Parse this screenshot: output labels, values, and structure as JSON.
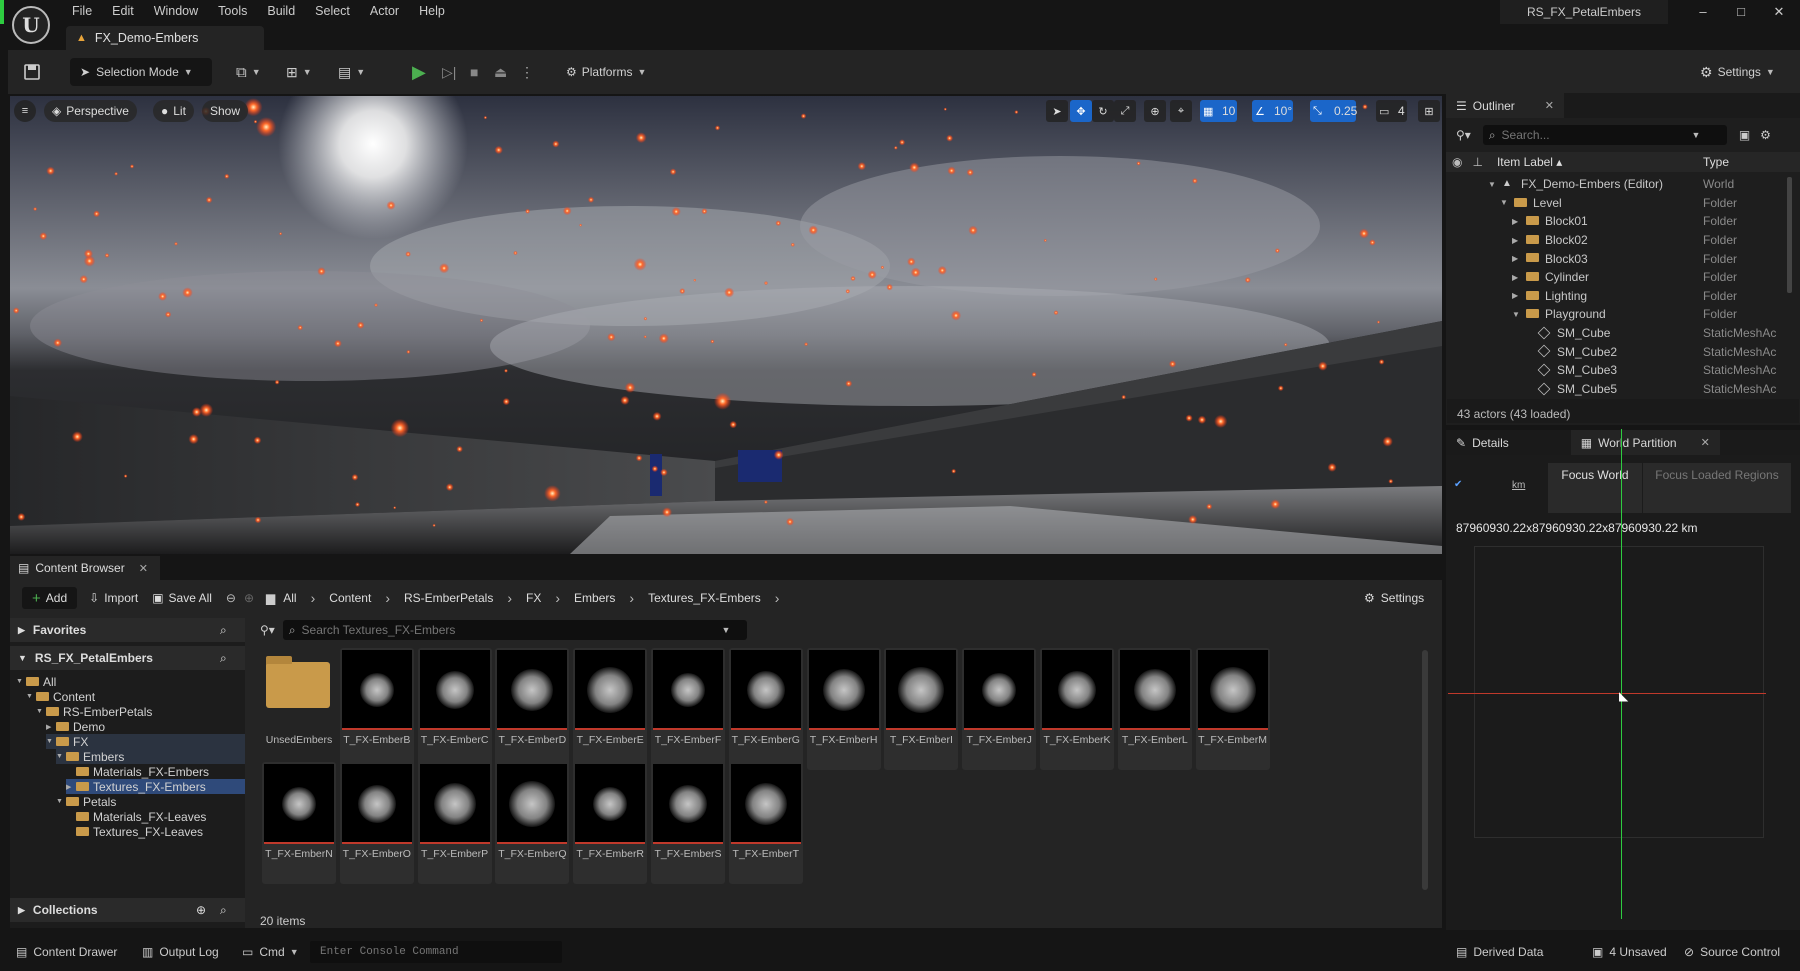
{
  "window": {
    "level_tab": "FX_Demo-Embers",
    "project_name": "RS_FX_PetalEmbers",
    "controls": [
      "–",
      "□",
      "✕"
    ]
  },
  "menu": [
    "File",
    "Edit",
    "Window",
    "Tools",
    "Build",
    "Select",
    "Actor",
    "Help"
  ],
  "toolbar": {
    "selection_mode": "Selection Mode",
    "platforms": "Platforms",
    "settings": "Settings"
  },
  "viewport": {
    "perspective": "Perspective",
    "lit": "Lit",
    "show": "Show",
    "grid_snap": "10",
    "rotation_snap": "10°",
    "scale_snap": "0.25",
    "camera_speed": "4"
  },
  "outliner": {
    "tab": "Outliner",
    "search_placeholder": "Search...",
    "col_label": "Item Label ▴",
    "col_type": "Type",
    "rows": [
      {
        "label": "FX_Demo-Embers (Editor)",
        "type": "World",
        "indent": 0,
        "icon": "world"
      },
      {
        "label": "Level",
        "type": "Folder",
        "indent": 1,
        "icon": "folder"
      },
      {
        "label": "Block01",
        "type": "Folder",
        "indent": 2,
        "icon": "folder"
      },
      {
        "label": "Block02",
        "type": "Folder",
        "indent": 2,
        "icon": "folder"
      },
      {
        "label": "Block03",
        "type": "Folder",
        "indent": 2,
        "icon": "folder"
      },
      {
        "label": "Cylinder",
        "type": "Folder",
        "indent": 2,
        "icon": "folder"
      },
      {
        "label": "Lighting",
        "type": "Folder",
        "indent": 2,
        "icon": "folder"
      },
      {
        "label": "Playground",
        "type": "Folder",
        "indent": 2,
        "icon": "folder"
      },
      {
        "label": "SM_Cube",
        "type": "StaticMeshAc",
        "indent": 3,
        "icon": "mesh"
      },
      {
        "label": "SM_Cube2",
        "type": "StaticMeshAc",
        "indent": 3,
        "icon": "mesh"
      },
      {
        "label": "SM_Cube3",
        "type": "StaticMeshAc",
        "indent": 3,
        "icon": "mesh"
      },
      {
        "label": "SM_Cube5",
        "type": "StaticMeshAc",
        "indent": 3,
        "icon": "mesh"
      }
    ],
    "footer": "43 actors (43 loaded)"
  },
  "details": {
    "tab": "Details",
    "tab2": "World Partition",
    "focus_world": "Focus World",
    "focus_loaded": "Focus Loaded Regions",
    "size_readout": "87960930.22x87960930.22x87960930.22 km",
    "km_label": "km"
  },
  "content_browser": {
    "tab": "Content Browser",
    "add": "Add",
    "import": "Import",
    "save_all": "Save All",
    "settings": "Settings",
    "breadcrumb": [
      "All",
      "Content",
      "RS-EmberPetals",
      "FX",
      "Embers",
      "Textures_FX-Embers"
    ],
    "favorites": "Favorites",
    "project": "RS_FX_PetalEmbers",
    "collections": "Collections",
    "search_placeholder": "Search Textures_FX-Embers",
    "tree": [
      {
        "label": "All",
        "depth": 0
      },
      {
        "label": "Content",
        "depth": 1
      },
      {
        "label": "RS-EmberPetals",
        "depth": 2
      },
      {
        "label": "Demo",
        "depth": 3
      },
      {
        "label": "FX",
        "depth": 3
      },
      {
        "label": "Embers",
        "depth": 4
      },
      {
        "label": "Materials_FX-Embers",
        "depth": 5
      },
      {
        "label": "Textures_FX-Embers",
        "depth": 5
      },
      {
        "label": "Petals",
        "depth": 4
      },
      {
        "label": "Materials_FX-Leaves",
        "depth": 5
      },
      {
        "label": "Textures_FX-Leaves",
        "depth": 5
      }
    ],
    "folder_item": "UnsedEmbers",
    "assets": [
      "T_FX-EmberB",
      "T_FX-EmberC",
      "T_FX-EmberD",
      "T_FX-EmberE",
      "T_FX-EmberF",
      "T_FX-EmberG",
      "T_FX-EmberH",
      "T_FX-EmberI",
      "T_FX-EmberJ",
      "T_FX-EmberK",
      "T_FX-EmberL",
      "T_FX-EmberM",
      "T_FX-EmberN",
      "T_FX-EmberO",
      "T_FX-EmberP",
      "T_FX-EmberQ",
      "T_FX-EmberR",
      "T_FX-EmberS",
      "T_FX-EmberT"
    ],
    "item_count": "20 items"
  },
  "statusbar": {
    "content_drawer": "Content Drawer",
    "output_log": "Output Log",
    "cmd": "Cmd",
    "console_placeholder": "Enter Console Command",
    "derived_data": "Derived Data",
    "unsaved": "4 Unsaved",
    "source_control": "Source Control"
  }
}
